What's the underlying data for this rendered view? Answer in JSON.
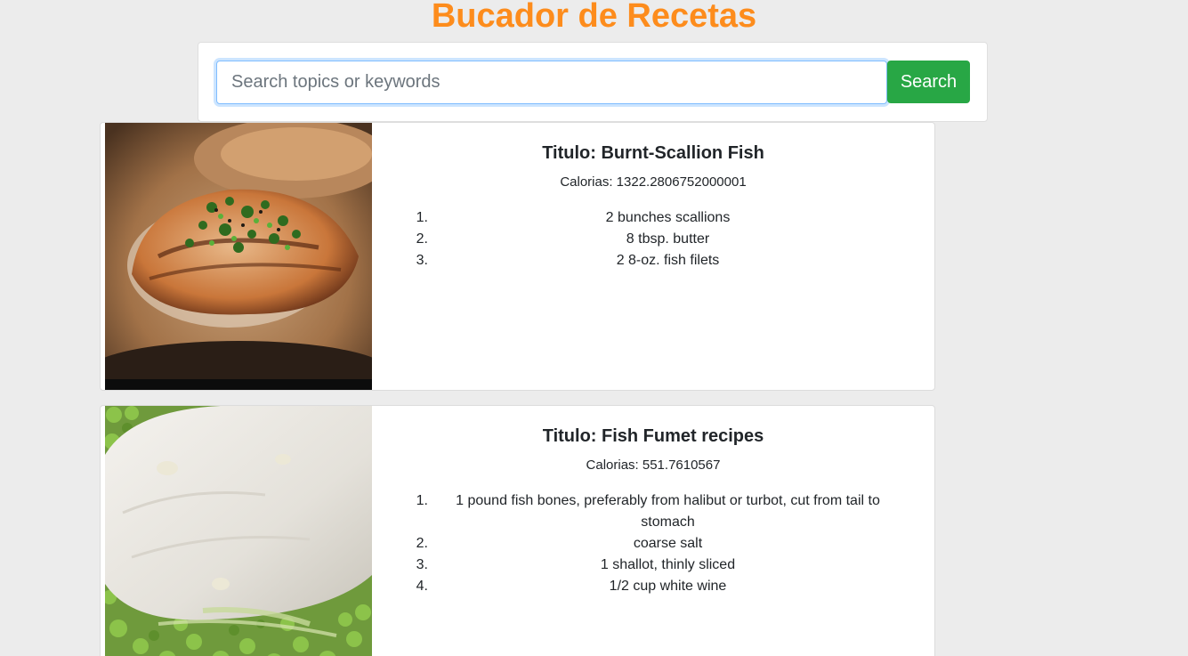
{
  "app": {
    "title": "Bucador de Recetas"
  },
  "search": {
    "placeholder": "Search topics or keywords",
    "value": "",
    "button_label": "Search"
  },
  "colors": {
    "title": "#fd8c1c",
    "search_button": "#28a745",
    "background": "#ececec"
  },
  "recipes": [
    {
      "title": "Titulo: Burnt-Scallion Fish",
      "calories": "Calorias: 1322.2806752000001",
      "ingredients": [
        {
          "num": "1.",
          "text": "2 bunches scallions"
        },
        {
          "num": "2.",
          "text": "8 tbsp. butter"
        },
        {
          "num": "3.",
          "text": "2 8-oz. fish filets"
        }
      ]
    },
    {
      "title": "Titulo: Fish Fumet recipes",
      "calories": "Calorias: 551.7610567",
      "ingredients": [
        {
          "num": "1.",
          "text": "1 pound fish bones, preferably from halibut or turbot, cut from tail to stomach"
        },
        {
          "num": "2.",
          "text": "coarse salt"
        },
        {
          "num": "3.",
          "text": "1 shallot, thinly sliced"
        },
        {
          "num": "4.",
          "text": "1/2 cup white wine"
        }
      ]
    }
  ]
}
